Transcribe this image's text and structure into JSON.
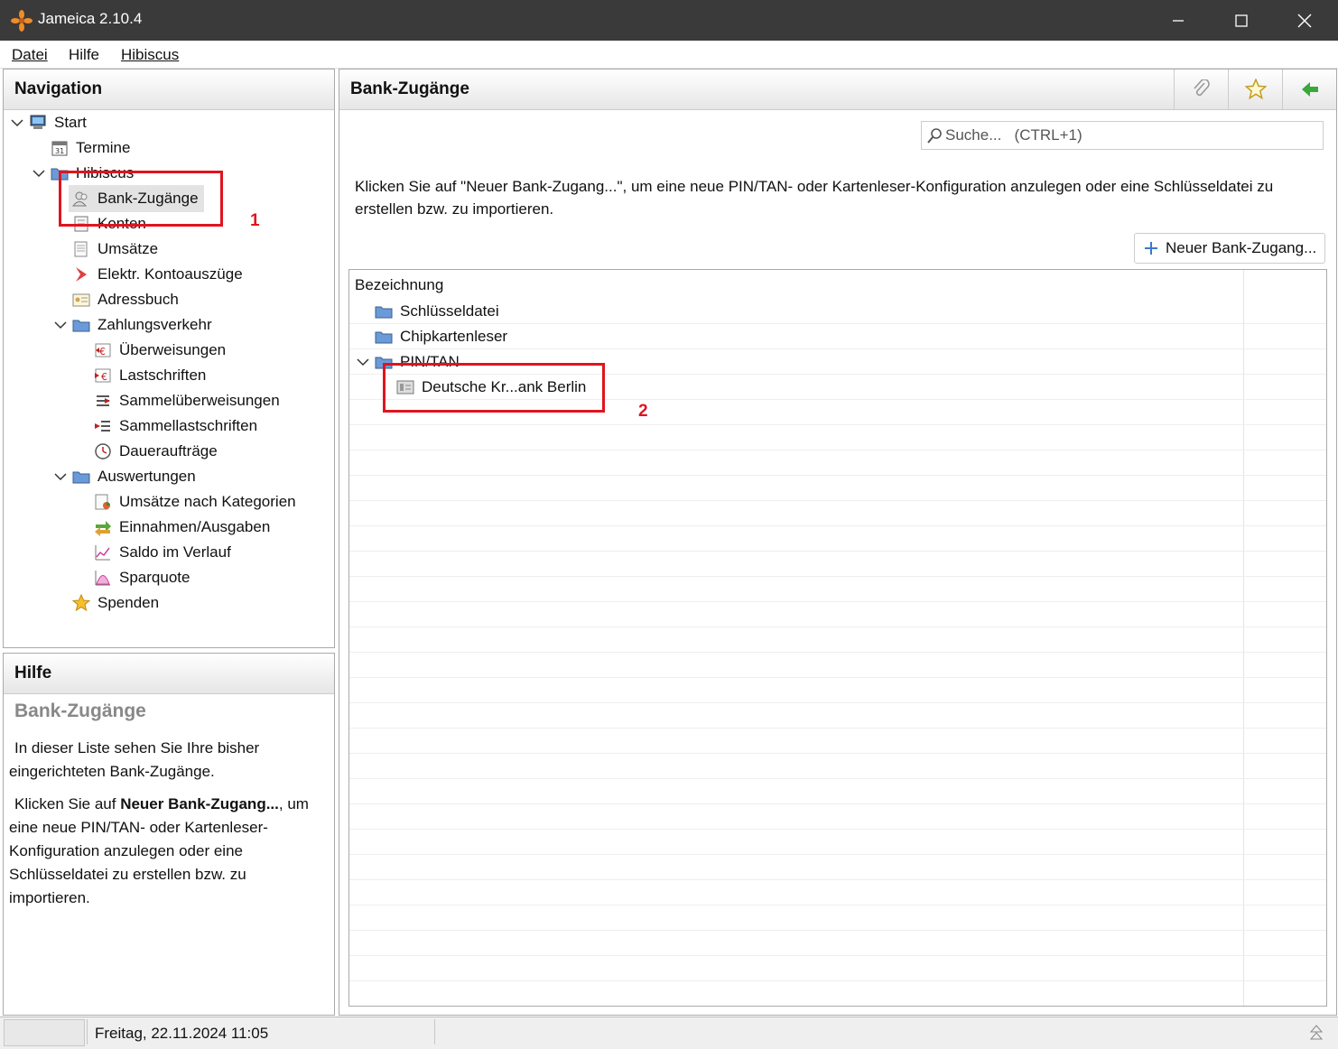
{
  "window": {
    "title": "Jameica 2.10.4"
  },
  "menu": {
    "items": [
      "Datei",
      "Hilfe",
      "Hibiscus"
    ]
  },
  "navigation": {
    "title": "Navigation",
    "items": [
      {
        "label": "Start"
      },
      {
        "label": "Termine"
      },
      {
        "label": "Hibiscus"
      },
      {
        "label": "Bank-Zugänge"
      },
      {
        "label": "Konten"
      },
      {
        "label": "Umsätze"
      },
      {
        "label": "Elektr. Kontoauszüge"
      },
      {
        "label": "Adressbuch"
      },
      {
        "label": "Zahlungsverkehr"
      },
      {
        "label": "Überweisungen"
      },
      {
        "label": "Lastschriften"
      },
      {
        "label": "Sammelüberweisungen"
      },
      {
        "label": "Sammellastschriften"
      },
      {
        "label": "Daueraufträge"
      },
      {
        "label": "Auswertungen"
      },
      {
        "label": "Umsätze nach Kategorien"
      },
      {
        "label": "Einnahmen/Ausgaben"
      },
      {
        "label": "Saldo im Verlauf"
      },
      {
        "label": "Sparquote"
      },
      {
        "label": "Spenden"
      }
    ]
  },
  "help": {
    "title": "Hilfe",
    "heading": "Bank-Zugänge",
    "para1": "In dieser Liste sehen Sie Ihre bisher eingerichteten Bank-Zugänge.",
    "para2_prefix": "Klicken Sie auf ",
    "para2_bold": "Neuer Bank-Zugang...",
    "para2_suffix": ", um eine neue PIN/TAN- oder Kartenleser-Konfiguration anzulegen oder eine Schlüsseldatei zu erstellen bzw. zu importieren."
  },
  "main": {
    "title": "Bank-Zugänge",
    "search_placeholder": "Suche...   (CTRL+1)",
    "info_text": "Klicken Sie auf \"Neuer Bank-Zugang...\", um eine neue PIN/TAN- oder Kartenleser-Konfiguration anzulegen oder eine Schlüsseldatei zu erstellen bzw. zu importieren.",
    "new_button": "Neuer Bank-Zugang...",
    "table": {
      "header": "Bezeichnung",
      "rows": [
        {
          "label": "Schlüsseldatei"
        },
        {
          "label": "Chipkartenleser"
        },
        {
          "label": "PIN/TAN"
        },
        {
          "label": "Deutsche Kr...ank Berlin"
        }
      ]
    }
  },
  "annotations": {
    "label1": "1",
    "label2": "2"
  },
  "status": {
    "datetime": "Freitag, 22.11.2024 11:05"
  },
  "colors": {
    "annotation": "#e0141e",
    "titlebar": "#3a3a3a",
    "selection": "#e3e3e3"
  }
}
